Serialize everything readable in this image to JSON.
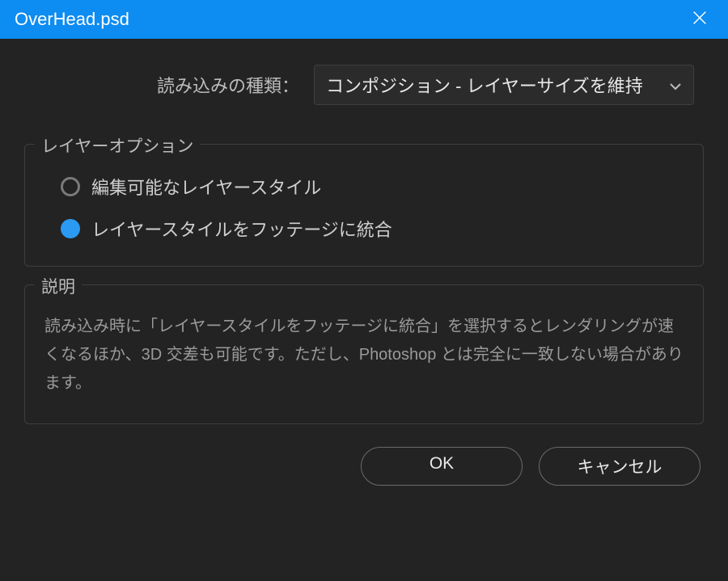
{
  "titlebar": {
    "title": "OverHead.psd"
  },
  "import": {
    "label": "読み込みの種類：",
    "selected": "コンポジション - レイヤーサイズを維持"
  },
  "layer_options": {
    "legend": "レイヤーオプション",
    "option1_label": "編集可能なレイヤースタイル",
    "option2_label": "レイヤースタイルをフッテージに統合"
  },
  "description": {
    "legend": "説明",
    "text": "読み込み時に「レイヤースタイルをフッテージに統合」を選択するとレンダリングが速くなるほか、3D 交差も可能です。ただし、Photoshop とは完全に一致しない場合があります。"
  },
  "buttons": {
    "ok": "OK",
    "cancel": "キャンセル"
  }
}
